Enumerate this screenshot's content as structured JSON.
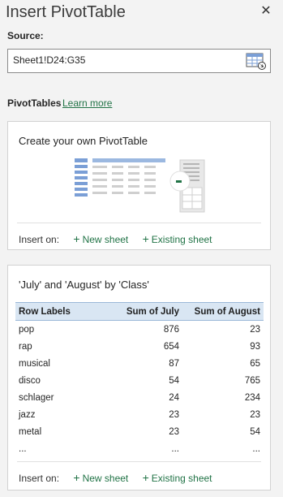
{
  "pane": {
    "title": "Insert PivotTable",
    "close_icon": "close-icon"
  },
  "source": {
    "label": "Source:",
    "value": "Sheet1!D24:G35",
    "range_icon": "range-select-icon"
  },
  "pivottables": {
    "label": "PivotTables",
    "learn_more": "Learn more"
  },
  "create_card": {
    "title": "Create your own PivotTable",
    "insert_on": "Insert on:",
    "new_sheet": "New sheet",
    "existing_sheet": "Existing sheet"
  },
  "recommended": {
    "title": "'July' and 'August' by 'Class'",
    "columns": [
      "Row Labels",
      "Sum of July",
      "Sum of August"
    ],
    "rows": [
      [
        "pop",
        "876",
        "23"
      ],
      [
        "rap",
        "654",
        "93"
      ],
      [
        "musical",
        "87",
        "65"
      ],
      [
        "disco",
        "54",
        "765"
      ],
      [
        "schlager",
        "24",
        "234"
      ],
      [
        "jazz",
        "23",
        "23"
      ],
      [
        "metal",
        "23",
        "54"
      ],
      [
        "...",
        "...",
        "..."
      ]
    ],
    "insert_on": "Insert on:",
    "new_sheet": "New sheet",
    "existing_sheet": "Existing sheet"
  },
  "colors": {
    "accent": "#217346",
    "header_bg": "#d9e6f3",
    "illustration_blue": "#7b9fd6"
  }
}
